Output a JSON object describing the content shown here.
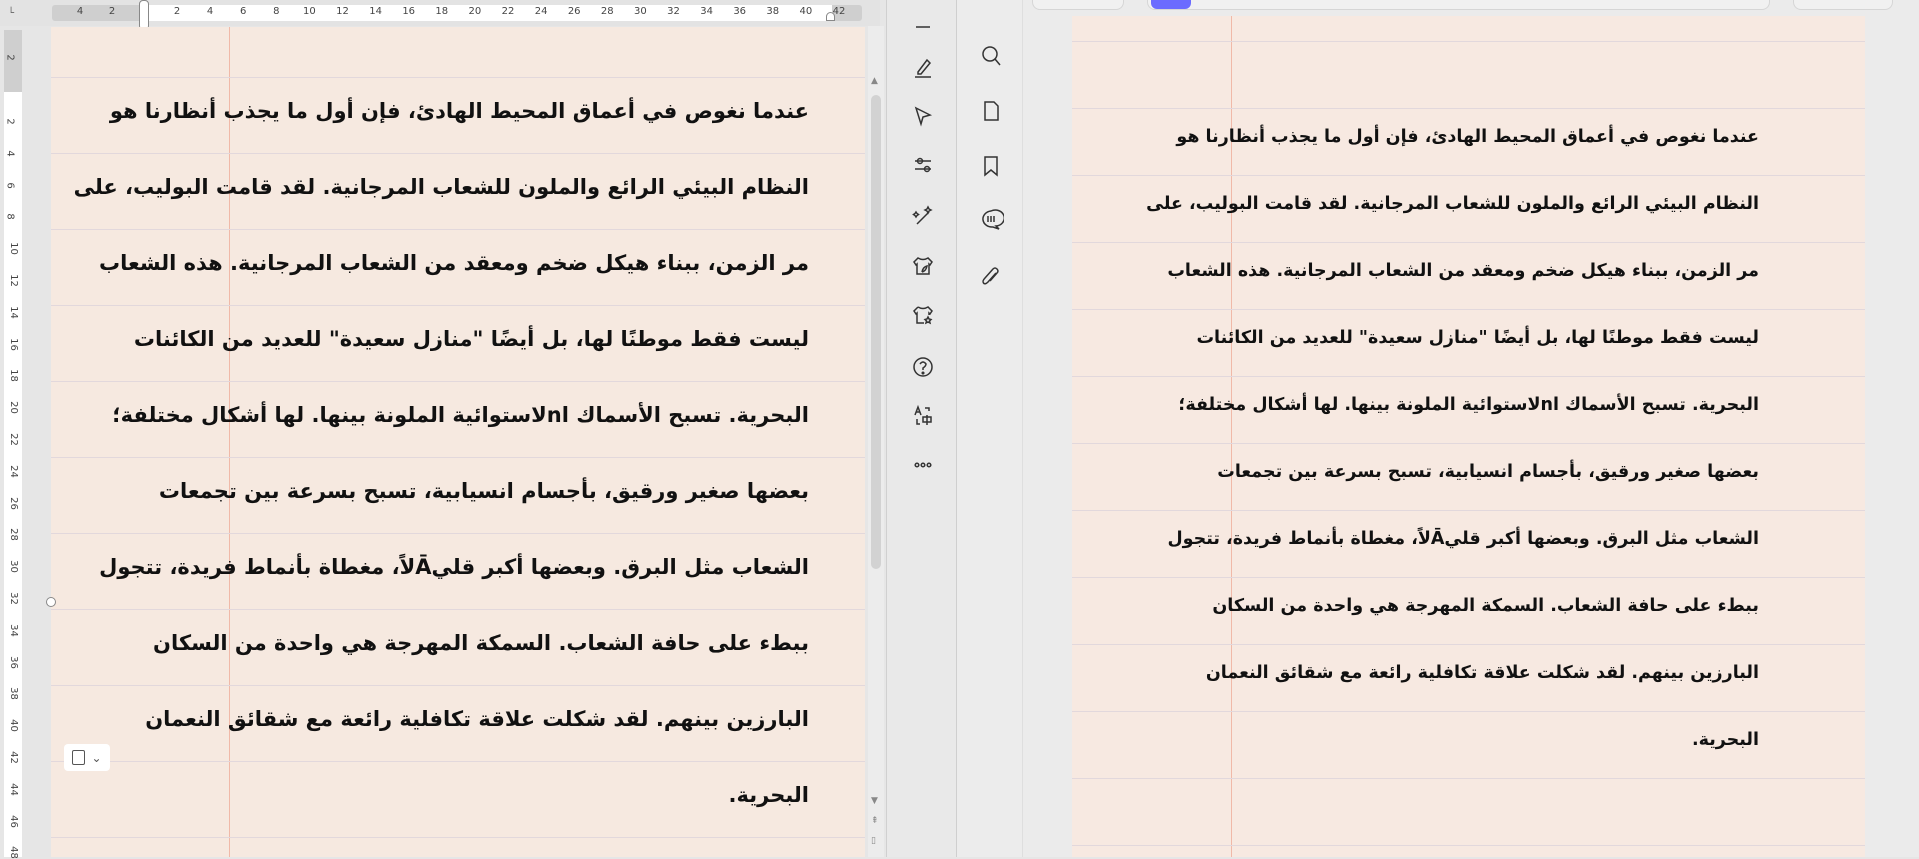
{
  "ruler": {
    "horizontal_left": [
      "4",
      "2"
    ],
    "horizontal": [
      "2",
      "4",
      "6",
      "8",
      "10",
      "12",
      "14",
      "16",
      "18",
      "20",
      "22",
      "24",
      "26",
      "28",
      "30",
      "32",
      "34",
      "36",
      "38",
      "40",
      "42"
    ],
    "vertical_top": "2",
    "vertical": [
      "2",
      "4",
      "6",
      "8",
      "10",
      "12",
      "14",
      "16",
      "18",
      "20",
      "22",
      "24",
      "26",
      "28",
      "30",
      "32",
      "34",
      "36",
      "38",
      "40",
      "42",
      "44",
      "46",
      "48"
    ]
  },
  "document": {
    "lines": [
      "عندما نغوص في أعماق المحيط الهادئ، فإن أول ما يجذب أنظارنا هو",
      "النظام البيئي الرائع والملون للشعاب المرجانية. لقد قامت البوليب، على",
      "مر الزمن، ببناء هيكل ضخم ومعقد من الشعاب المرجانية. هذه الشعاب",
      "ليست فقط موطنًا لها، بل أيضًا \"منازل سعيدة\" للعديد من الكائنات",
      "البحرية. تسبح الأسماك اnلاستوائية الملونة بينها. لها أشكال مختلفة؛",
      "بعضها صغير ورقيق، بأجسام انسيابية، تسبح بسرعة بين تجمعات",
      "الشعاب مثل البرق. وبعضها أكبر قليĀلاً، مغطاة بأنماط فريدة، تتجول",
      "ببطء على حافة الشعاب. السمكة المهرجة هي واحدة من السكان",
      "البارزين بينهم. لقد شكلت علاقة تكافلية رائعة مع شقائق النعمان",
      "البحرية."
    ]
  },
  "tools": {
    "left": [
      "minus-icon",
      "pen-icon",
      "cursor-icon",
      "sliders-icon",
      "magic-wand-icon",
      "shirt-leaf-icon",
      "shirt-star-icon",
      "help-icon",
      "translate-icon",
      "more-icon"
    ],
    "right": [
      "search-icon",
      "page-icon",
      "bookmark-icon",
      "comment-icon",
      "paperclip-icon"
    ]
  },
  "colors": {
    "page": "#f6e9e0",
    "margin": "#f0b9a8",
    "accent": "#6b6bff"
  }
}
